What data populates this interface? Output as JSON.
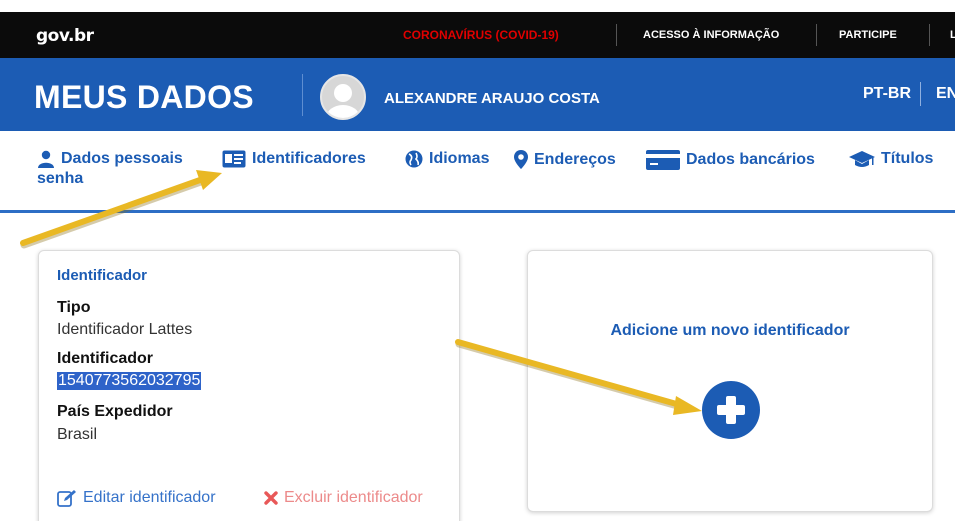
{
  "topbar": {
    "logo": "gov.br",
    "links": [
      "CORONAVÍRUS (COVID-19)",
      "ACESSO À INFORMAÇÃO",
      "PARTICIPE",
      "L"
    ]
  },
  "header": {
    "title": "MEUS DADOS",
    "user_name": "ALEXANDRE ARAUJO COSTA",
    "languages": [
      "PT-BR",
      "EN"
    ]
  },
  "nav": {
    "items": [
      {
        "label": "Dados pessoais",
        "icon": "user-icon"
      },
      {
        "label": "Identificadores",
        "icon": "id-card-icon"
      },
      {
        "label": "Idiomas",
        "icon": "globe-icon"
      },
      {
        "label": "Endereços",
        "icon": "map-marker-icon"
      },
      {
        "label": "Dados bancários",
        "icon": "credit-card-icon"
      },
      {
        "label": "Títulos",
        "icon": "graduation-cap-icon"
      }
    ],
    "wrap_label": "senha"
  },
  "identifier_card": {
    "heading": "Identificador",
    "type_label": "Tipo",
    "type_value": "Identificador Lattes",
    "id_label": "Identificador",
    "id_value": "1540773562032795",
    "country_label": "País Expedidor",
    "country_value": "Brasil",
    "edit_label": "Editar identificador",
    "delete_label": "Excluir identificador"
  },
  "add_card": {
    "label": "Adicione um novo identificador",
    "button_icon": "plus-circle-icon"
  },
  "colors": {
    "brand_blue": "#1c5cb4",
    "annotation_arrow": "#e9b824",
    "covid_red": "#e00000",
    "delete_red": "#ec8a8a"
  }
}
